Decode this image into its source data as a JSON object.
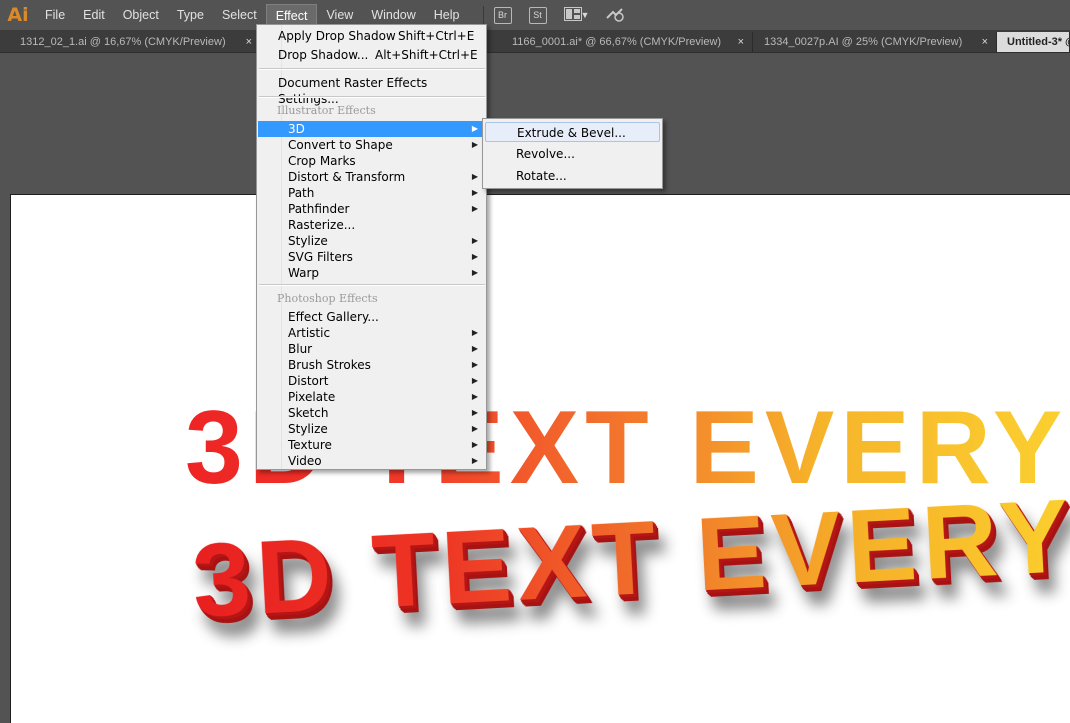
{
  "app": {
    "logo": "Ai"
  },
  "menubar": {
    "items": [
      "File",
      "Edit",
      "Object",
      "Type",
      "Select",
      "Effect",
      "View",
      "Window",
      "Help"
    ],
    "active": "Effect",
    "toolbar": {
      "bridge": "Br",
      "stock": "St",
      "arrange_icon": "arrange-documents-icon",
      "sync_icon": "sync-settings-icon"
    }
  },
  "tabs": [
    {
      "label": "1312_02_1.ai @ 16,67% (CMYK/Preview)",
      "close": "×"
    },
    {
      "label": "1166_0001.ai* @ 66,67% (CMYK/Preview)",
      "close": "×"
    },
    {
      "label": "1334_0027p.AI @ 25% (CMYK/Preview)",
      "close": "×"
    },
    {
      "label": "Untitled-3* @",
      "close": "",
      "current": true
    }
  ],
  "effect_menu": {
    "apply_drop_shadow": {
      "label": "Apply Drop Shadow",
      "shortcut": "Shift+Ctrl+E"
    },
    "drop_shadow": {
      "label": "Drop Shadow...",
      "shortcut": "Alt+Shift+Ctrl+E"
    },
    "raster_settings": "Document Raster Effects Settings...",
    "illustrator_effects_header": "Illustrator Effects",
    "illustrator_effects": [
      {
        "label": "3D",
        "submenu": true,
        "highlighted": true
      },
      {
        "label": "Convert to Shape",
        "submenu": true
      },
      {
        "label": "Crop Marks",
        "submenu": false
      },
      {
        "label": "Distort & Transform",
        "submenu": true
      },
      {
        "label": "Path",
        "submenu": true
      },
      {
        "label": "Pathfinder",
        "submenu": true
      },
      {
        "label": "Rasterize...",
        "submenu": false
      },
      {
        "label": "Stylize",
        "submenu": true
      },
      {
        "label": "SVG Filters",
        "submenu": true
      },
      {
        "label": "Warp",
        "submenu": true
      }
    ],
    "photoshop_effects_header": "Photoshop Effects",
    "photoshop_effects": [
      {
        "label": "Effect Gallery...",
        "submenu": false
      },
      {
        "label": "Artistic",
        "submenu": true
      },
      {
        "label": "Blur",
        "submenu": true
      },
      {
        "label": "Brush Strokes",
        "submenu": true
      },
      {
        "label": "Distort",
        "submenu": true
      },
      {
        "label": "Pixelate",
        "submenu": true
      },
      {
        "label": "Sketch",
        "submenu": true
      },
      {
        "label": "Stylize",
        "submenu": true
      },
      {
        "label": "Texture",
        "submenu": true
      },
      {
        "label": "Video",
        "submenu": true
      }
    ],
    "submenu_arrow": "▶"
  },
  "submenu_3d": {
    "items": [
      "Extrude & Bevel...",
      "Revolve...",
      "Rotate..."
    ],
    "hovered": "Extrude & Bevel..."
  },
  "artwork": {
    "flat_text": "3D TEXT EVERY",
    "extruded_text": "3D TEXT EVERY",
    "gradient_colors": [
      "#ee2424",
      "#f37c2c",
      "#fbd030"
    ],
    "extrude_color": "#b51515"
  },
  "colors": {
    "menubar_bg": "#535353",
    "tabbar_bg": "#3c3c3c",
    "menu_bg": "#f0f0f0",
    "highlight": "#3399ff",
    "logo": "#d98a2b"
  }
}
